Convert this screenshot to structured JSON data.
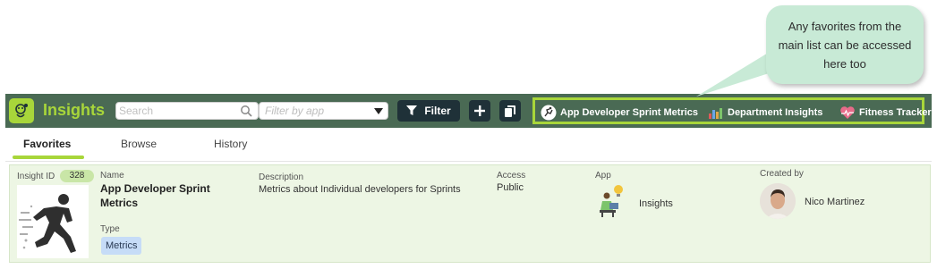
{
  "callout": {
    "text": "Any favorites from the main list can be accessed here too"
  },
  "appbar": {
    "title": "Insights",
    "search_placeholder": "Search",
    "filter_placeholder": "Filter by app",
    "filter_button": "Filter",
    "favorites": [
      {
        "label": "App Developer Sprint Metrics",
        "icon": "runner-icon"
      },
      {
        "label": "Department Insights",
        "icon": "bar-chart-icon"
      },
      {
        "label": "Fitness Tracker",
        "icon": "heart-pulse-icon"
      }
    ]
  },
  "tabs": [
    {
      "label": "Favorites",
      "active": true
    },
    {
      "label": "Browse",
      "active": false
    },
    {
      "label": "History",
      "active": false
    }
  ],
  "card": {
    "insight_id_label": "Insight ID",
    "insight_id": "328",
    "name_label": "Name",
    "name": "App Developer Sprint Metrics",
    "type_label": "Type",
    "type": "Metrics",
    "description_label": "Description",
    "description": "Metrics about Individual developers for Sprints",
    "access_label": "Access",
    "access": "Public",
    "app_label": "App",
    "app": "Insights",
    "created_by_label": "Created by",
    "created_by": "Nico Martinez"
  },
  "colors": {
    "appbar": "#4a6a54",
    "accent": "#a8d63a",
    "button_dark": "#1f3138",
    "card_bg": "#edf6e4",
    "callout_bg": "#c8ead6"
  }
}
